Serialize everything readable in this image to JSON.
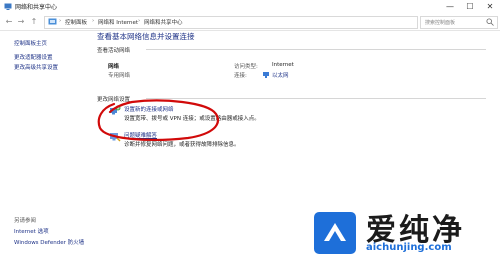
{
  "window": {
    "title": "网络和共享中心",
    "minimize": "—",
    "maximize": "☐",
    "close": "✕"
  },
  "address": {
    "back": "←",
    "forward": "→",
    "up": "↑",
    "crumbs": [
      "控制面板",
      "网络和 Internet",
      "网络和共享中心"
    ],
    "separator": "›",
    "search_placeholder": "搜索控制面板"
  },
  "sidebar": {
    "links": [
      "控制面板主页",
      "更改适配器设置",
      "更改高级共享设置"
    ],
    "see_also_title": "另请参阅",
    "see_also": [
      "Internet 选项",
      "Windows Defender 防火墙"
    ]
  },
  "main": {
    "heading": "查看基本网络信息并设置连接",
    "active_section": "查看活动网络",
    "network_name": "网络",
    "network_type": "专用网络",
    "access_type_label": "访问类型:",
    "access_type_value": "Internet",
    "connections_label": "连接:",
    "connections_value": "以太网",
    "change_section": "更改网络设置",
    "setup_title": "设置新的连接或网络",
    "setup_desc": "设置宽带、拨号或 VPN 连接；或设置路由器或接入点。",
    "troubleshoot_title": "问题疑难解答",
    "troubleshoot_desc": "诊断并修复网络问题，或者获得故障排除信息。"
  },
  "watermark": {
    "text": "爱纯净",
    "url": "aichunjing.com"
  },
  "colors": {
    "link": "#1e3287",
    "annotation": "#d10a0a",
    "logo_blue": "#1e6fd9"
  }
}
